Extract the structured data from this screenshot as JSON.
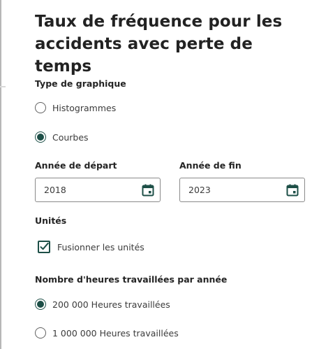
{
  "title": "Taux de fréquence pour les accidents avec perte de temps",
  "chart_type": {
    "label": "Type de graphique",
    "options": [
      {
        "label": "Histogrammes",
        "selected": false
      },
      {
        "label": "Courbes",
        "selected": true
      }
    ]
  },
  "start_year": {
    "label": "Année de départ",
    "value": "2018",
    "icon": "calendar-icon"
  },
  "end_year": {
    "label": "Année de fin",
    "value": "2023",
    "icon": "calendar-icon"
  },
  "units": {
    "label": "Unités",
    "merge_label": "Fusionner les unités",
    "merge_checked": true
  },
  "hours": {
    "label": "Nombre d'heures travaillées par année",
    "options": [
      {
        "label": "200 000 Heures travaillées",
        "selected": true
      },
      {
        "label": "1 000 000 Heures travaillées",
        "selected": false
      }
    ]
  },
  "colors": {
    "accent": "#1d4f47",
    "text": "#242424",
    "border": "#8a8a8a"
  }
}
